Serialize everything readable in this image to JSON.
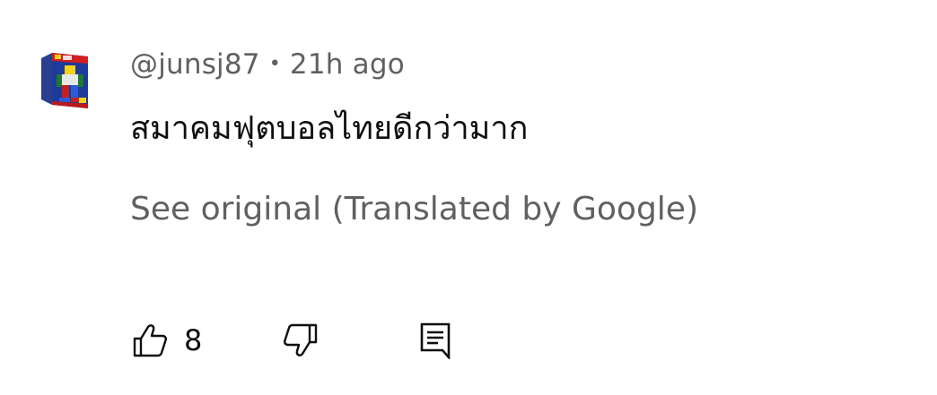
{
  "comment": {
    "handle": "@junsj87",
    "separator": "•",
    "time": "21h ago",
    "text": "สมาคมฟุตบอลไทยดีกว่ามาก",
    "see_original": "See original (Translated by Google)"
  },
  "actions": {
    "like_icon": "thumbs-up-icon",
    "like_count": "8",
    "dislike_icon": "thumbs-down-icon",
    "reply_icon": "reply-icon"
  },
  "colors": {
    "primary_text": "#0f0f0f",
    "secondary_text": "#606060",
    "background": "#ffffff"
  }
}
